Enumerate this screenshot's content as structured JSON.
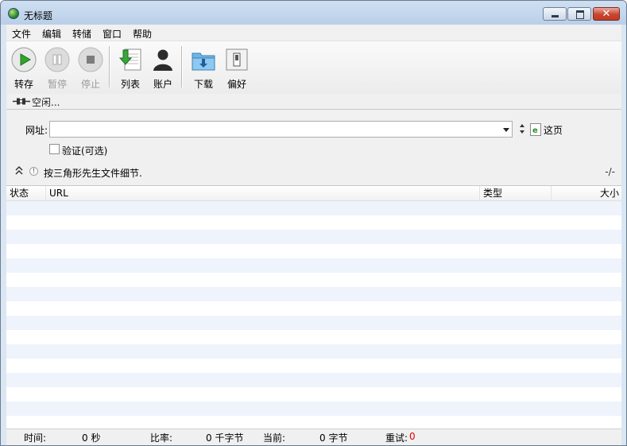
{
  "window": {
    "title": "无标题"
  },
  "menu": [
    "文件",
    "编辑",
    "转储",
    "窗口",
    "帮助"
  ],
  "toolbar": {
    "save": "转存",
    "pause": "暂停",
    "stop": "停止",
    "list": "列表",
    "account": "账户",
    "download": "下载",
    "prefs": "偏好"
  },
  "status": {
    "text": "空闲..."
  },
  "form": {
    "url_label": "网址:",
    "url_value": "",
    "this_page": "这页",
    "verify_label": "验证(可选)"
  },
  "hint": {
    "text": "按三角形先生文件细节.",
    "progress": "-/-"
  },
  "table": {
    "columns": [
      "状态",
      "URL",
      "类型",
      "大小"
    ]
  },
  "footer": {
    "time_label": "时间:",
    "time_value": "0 秒",
    "ratio_label": "比率:",
    "ratio_value": "0 千字节",
    "current_label": "当前:",
    "current_value": "0 字节",
    "retry_label": "重试:",
    "retry_value": "0"
  }
}
